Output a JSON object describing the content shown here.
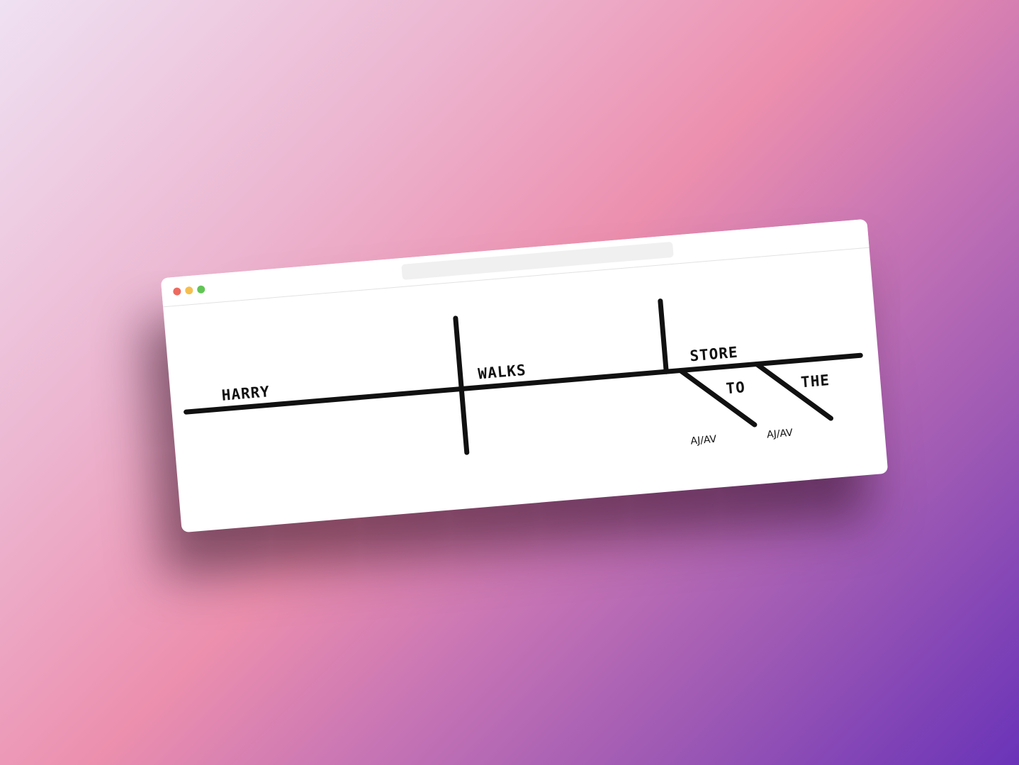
{
  "diagram": {
    "words": {
      "subject": "HARRY",
      "verb": "WALKS",
      "object": "STORE",
      "modifier_1": "TO",
      "modifier_2": "THE"
    },
    "modifier_tags": [
      "AJ/AV",
      "AJ/AV"
    ]
  },
  "colors": {
    "line": "#111111",
    "background_start": "#efe1f2",
    "background_end": "#6a33b8"
  }
}
